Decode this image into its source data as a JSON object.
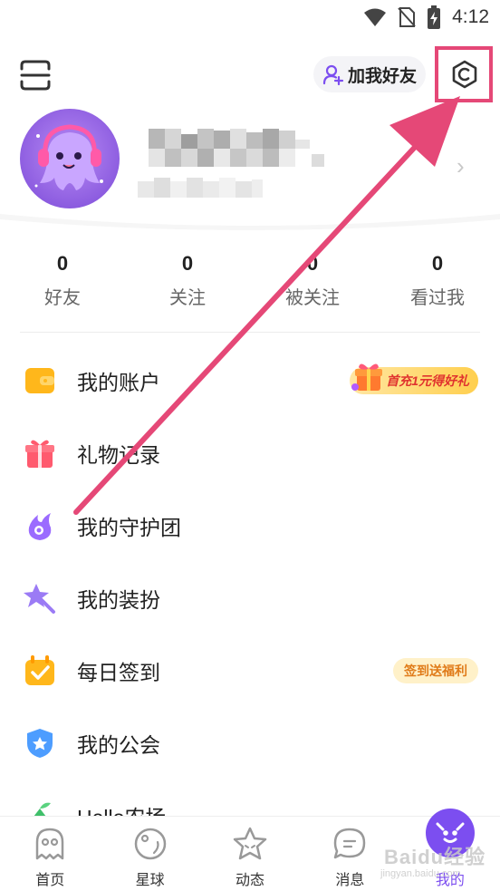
{
  "status_bar": {
    "time": "4:12",
    "icons": [
      "wifi-icon",
      "no-sim-icon",
      "battery-charging-icon"
    ]
  },
  "header": {
    "scan_icon": "scan-icon",
    "add_friend_label": "加我好友",
    "settings_icon": "settings-hexagon-icon"
  },
  "profile": {
    "avatar": "octopus-headphones-avatar",
    "name": ""
  },
  "stats": [
    {
      "value": "0",
      "label": "好友"
    },
    {
      "value": "0",
      "label": "关注"
    },
    {
      "value": "0",
      "label": "被关注"
    },
    {
      "value": "0",
      "label": "看过我"
    }
  ],
  "menu": [
    {
      "label": "我的账户",
      "icon": "wallet-icon",
      "badge": "首充1元得好礼"
    },
    {
      "label": "礼物记录",
      "icon": "gift-icon"
    },
    {
      "label": "我的守护团",
      "icon": "guard-flame-icon"
    },
    {
      "label": "我的装扮",
      "icon": "star-wand-icon"
    },
    {
      "label": "每日签到",
      "icon": "calendar-check-icon",
      "badge": "签到送福利"
    },
    {
      "label": "我的公会",
      "icon": "guild-shield-icon"
    },
    {
      "label": "Hello农场",
      "icon": "farm-icon"
    }
  ],
  "bottom_nav": [
    {
      "label": "首页",
      "icon": "home-ghost-icon"
    },
    {
      "label": "星球",
      "icon": "planet-icon"
    },
    {
      "label": "动态",
      "icon": "star-face-icon"
    },
    {
      "label": "消息",
      "icon": "message-bubble-icon"
    },
    {
      "label": "我的",
      "icon": "me-face-icon",
      "active": true
    }
  ],
  "watermark": {
    "text": "Baidu经验",
    "sub": "jingyan.baidu.com"
  },
  "colors": {
    "accent": "#7c4ef0",
    "highlight": "#e54877",
    "badge_text": "#e0332f"
  }
}
